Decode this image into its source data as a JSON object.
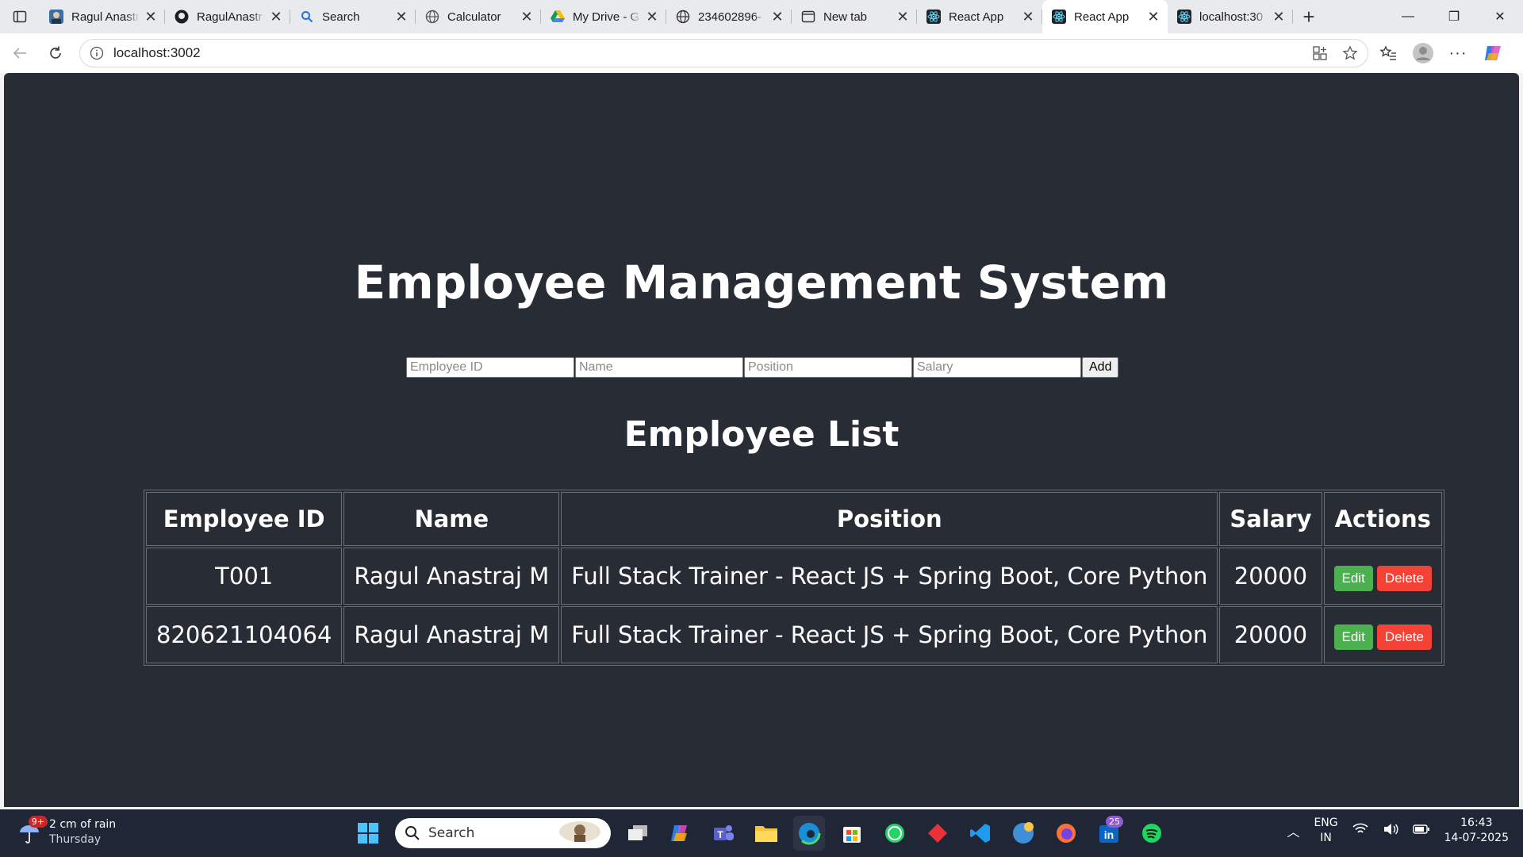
{
  "browser": {
    "tabs": [
      {
        "title": "Ragul Anastr",
        "icon": "profile-photo-icon"
      },
      {
        "title": "RagulAnastr",
        "icon": "github-icon"
      },
      {
        "title": "Search",
        "icon": "search-icon"
      },
      {
        "title": "Calculator",
        "icon": "globe-icon"
      },
      {
        "title": "My Drive - G",
        "icon": "google-drive-icon"
      },
      {
        "title": "234602896-",
        "icon": "globe-icon"
      },
      {
        "title": "New tab",
        "icon": "new-tab-icon"
      },
      {
        "title": "React App",
        "icon": "react-icon"
      },
      {
        "title": "React App",
        "icon": "react-icon",
        "active": true
      },
      {
        "title": "localhost:30",
        "icon": "react-icon"
      }
    ],
    "address": "localhost:3002"
  },
  "app": {
    "title": "Employee Management System",
    "form": {
      "id_placeholder": "Employee ID",
      "name_placeholder": "Name",
      "position_placeholder": "Position",
      "salary_placeholder": "Salary",
      "add_label": "Add"
    },
    "list_title": "Employee List",
    "table": {
      "headers": [
        "Employee ID",
        "Name",
        "Position",
        "Salary",
        "Actions"
      ],
      "rows": [
        {
          "id": "T001",
          "name": "Ragul Anastraj M",
          "position": "Full Stack Trainer - React JS + Spring Boot, Core Python",
          "salary": "20000"
        },
        {
          "id": "820621104064",
          "name": "Ragul Anastraj M",
          "position": "Full Stack Trainer - React JS + Spring Boot, Core Python",
          "salary": "20000"
        }
      ],
      "edit_label": "Edit",
      "delete_label": "Delete"
    },
    "colors": {
      "background": "#282c34",
      "edit": "#4caf50",
      "delete": "#f44336"
    }
  },
  "taskbar": {
    "weather": {
      "line1": "2 cm of rain",
      "line2": "Thursday",
      "badge": "9+"
    },
    "search_label": "Search",
    "linkedin_badge": "25",
    "language": {
      "line1": "ENG",
      "line2": "IN"
    },
    "clock": {
      "time": "16:43",
      "date": "14-07-2025"
    }
  }
}
